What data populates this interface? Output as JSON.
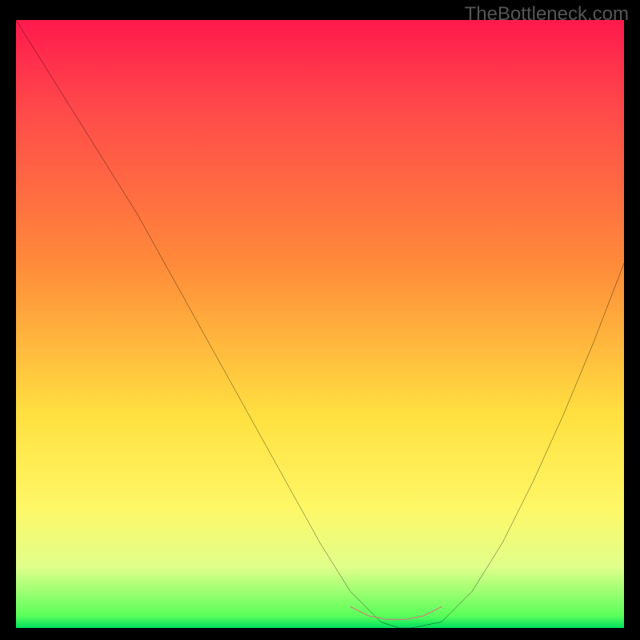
{
  "attribution": "TheBottleneck.com",
  "chart_data": {
    "type": "line",
    "title": "",
    "xlabel": "",
    "ylabel": "",
    "xlim": [
      0,
      100
    ],
    "ylim": [
      0,
      100
    ],
    "grid": false,
    "series": [
      {
        "name": "bottleneck-curve",
        "color": "#000000",
        "x": [
          0,
          5,
          10,
          15,
          20,
          25,
          30,
          35,
          40,
          45,
          50,
          55,
          60,
          63,
          65,
          70,
          75,
          80,
          85,
          90,
          95,
          100
        ],
        "y": [
          100,
          92,
          84,
          76,
          68,
          59,
          50,
          41,
          32,
          23,
          14,
          6,
          1,
          0,
          0,
          1,
          6,
          14,
          24,
          35,
          47,
          60
        ]
      },
      {
        "name": "highlight-segment",
        "color": "#d97a7a",
        "x": [
          55,
          58,
          61,
          64,
          67,
          70
        ],
        "y": [
          3.5,
          2.0,
          1.4,
          1.4,
          2.0,
          3.5
        ]
      }
    ],
    "gradient_stops": [
      {
        "pos": 0.0,
        "color": "#ff1a4d"
      },
      {
        "pos": 0.15,
        "color": "#ff4a4a"
      },
      {
        "pos": 0.4,
        "color": "#ff8a3a"
      },
      {
        "pos": 0.65,
        "color": "#ffe040"
      },
      {
        "pos": 0.8,
        "color": "#fff766"
      },
      {
        "pos": 0.9,
        "color": "#e0ff8a"
      },
      {
        "pos": 0.98,
        "color": "#5aff5a"
      },
      {
        "pos": 1.0,
        "color": "#00e060"
      }
    ]
  }
}
